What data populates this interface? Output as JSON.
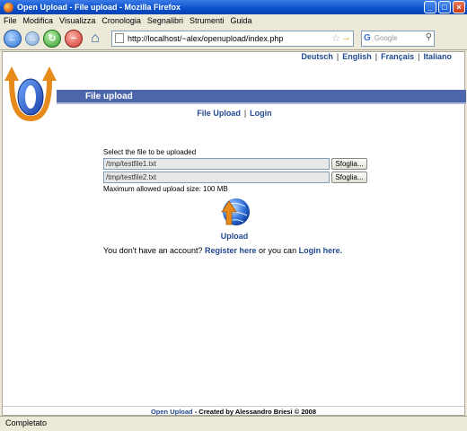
{
  "window": {
    "title": "Open Upload - File upload - Mozilla Firefox",
    "min": "_",
    "max": "□",
    "close": "×"
  },
  "menu": [
    "File",
    "Modifica",
    "Visualizza",
    "Cronologia",
    "Segnalibri",
    "Strumenti",
    "Guida"
  ],
  "nav": {
    "url": "http://localhost/~alex/openupload/index.php",
    "search_placeholder": "Google"
  },
  "page": {
    "languages": [
      "Deutsch",
      "English",
      "Français",
      "Italiano"
    ],
    "header_title": "File upload",
    "top_links": [
      "File Upload",
      "Login"
    ],
    "select_label": "Select the file to be uploaded",
    "files": [
      "/tmp/testfile1.txt",
      "/tmp/testfile2.txt"
    ],
    "browse_label": "Sfoglia...",
    "max_size": "Maximum allowed upload size: 100 MB",
    "upload_label": "Upload",
    "account_prefix": "You don't have an account?",
    "register_link": "Register here",
    "account_middle": "or you can",
    "login_link": "Login here.",
    "footer_link": "Open Upload",
    "footer_text": "- Created by Alessandro Briesi © 2008"
  },
  "status": "Completato",
  "icons": {
    "back": "back-arrow-icon",
    "forward": "forward-arrow-icon",
    "reload": "reload-icon",
    "stop": "stop-icon",
    "home": "home-icon"
  }
}
